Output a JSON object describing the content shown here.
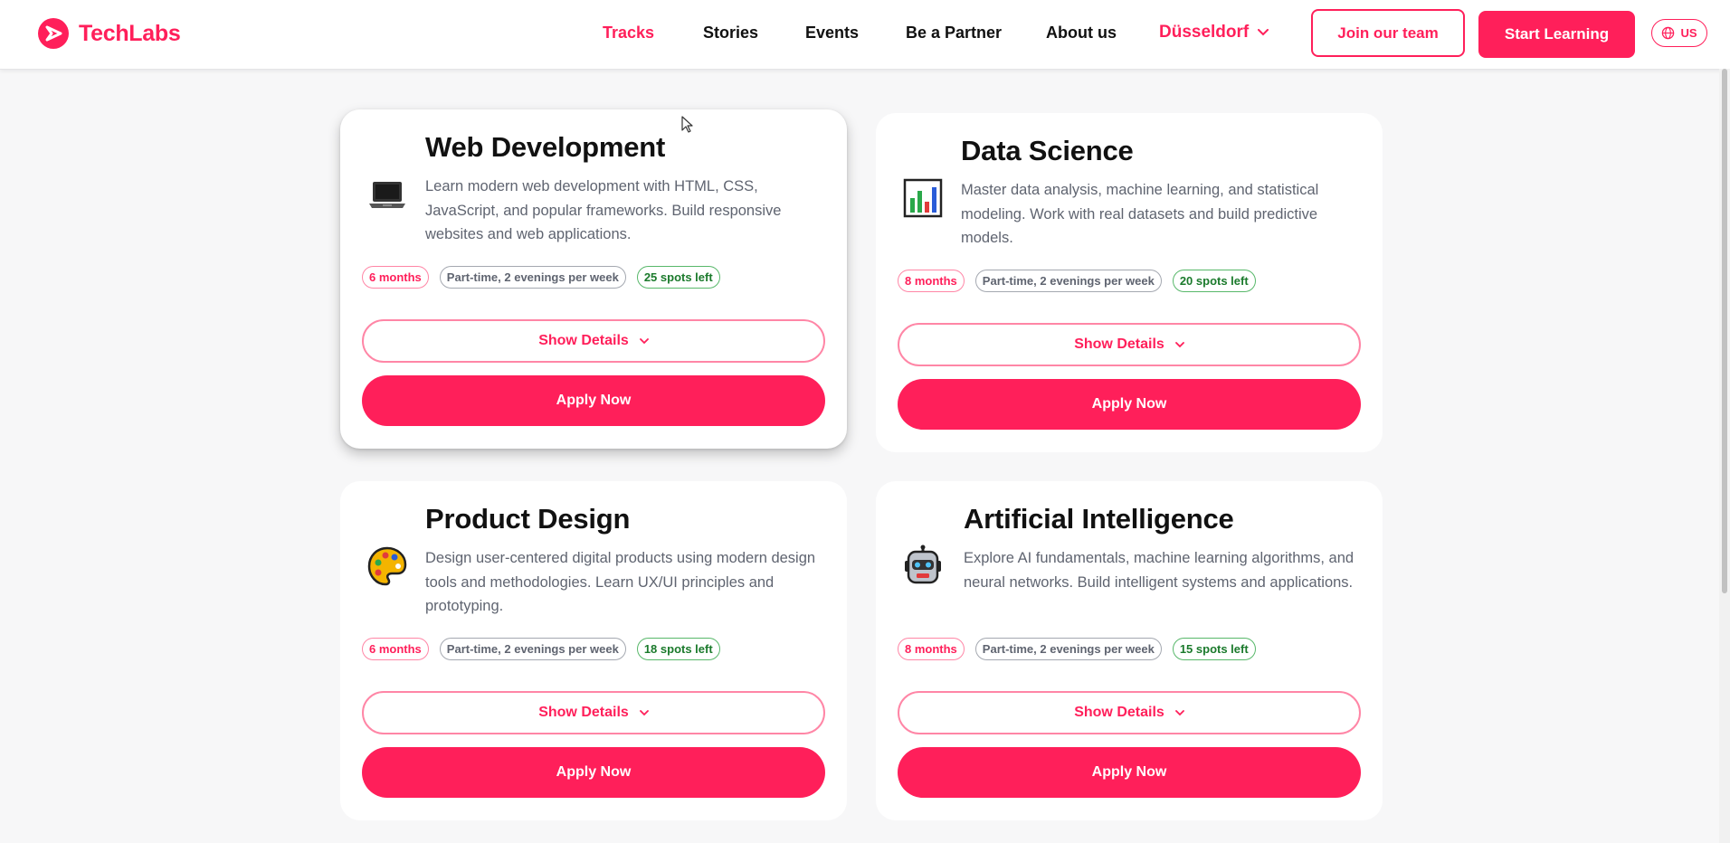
{
  "header": {
    "logo_text": "TechLabs",
    "nav": [
      {
        "label": "Tracks",
        "active": true
      },
      {
        "label": "Stories"
      },
      {
        "label": "Events"
      },
      {
        "label": "Be a Partner"
      },
      {
        "label": "About us"
      }
    ],
    "city": "Düsseldorf",
    "join_label": "Join our team",
    "start_label": "Start Learning",
    "lang_label": "US"
  },
  "colors": {
    "accent": "#ff1f5a",
    "green": "#1b7a2c",
    "gray_text": "#5f6470"
  },
  "cards": [
    {
      "icon": "laptop-icon",
      "title": "Web Development",
      "description": "Learn modern web development with HTML, CSS, JavaScript, and popular frameworks. Build responsive websites and web applications.",
      "duration": "6 months",
      "schedule": "Part-time, 2 evenings per week",
      "spots": "25 spots left",
      "details_label": "Show Details",
      "apply_label": "Apply Now"
    },
    {
      "icon": "bar-chart-icon",
      "title": "Data Science",
      "description": "Master data analysis, machine learning, and statistical modeling. Work with real datasets and build predictive models.",
      "duration": "8 months",
      "schedule": "Part-time, 2 evenings per week",
      "spots": "20 spots left",
      "details_label": "Show Details",
      "apply_label": "Apply Now"
    },
    {
      "icon": "palette-icon",
      "title": "Product Design",
      "description": "Design user-centered digital products using modern design tools and methodologies. Learn UX/UI principles and prototyping.",
      "duration": "6 months",
      "schedule": "Part-time, 2 evenings per week",
      "spots": "18 spots left",
      "details_label": "Show Details",
      "apply_label": "Apply Now"
    },
    {
      "icon": "robot-icon",
      "title": "Artificial Intelligence",
      "description": "Explore AI fundamentals, machine learning algorithms, and neural networks. Build intelligent systems and applications.",
      "duration": "8 months",
      "schedule": "Part-time, 2 evenings per week",
      "spots": "15 spots left",
      "details_label": "Show Details",
      "apply_label": "Apply Now"
    }
  ]
}
